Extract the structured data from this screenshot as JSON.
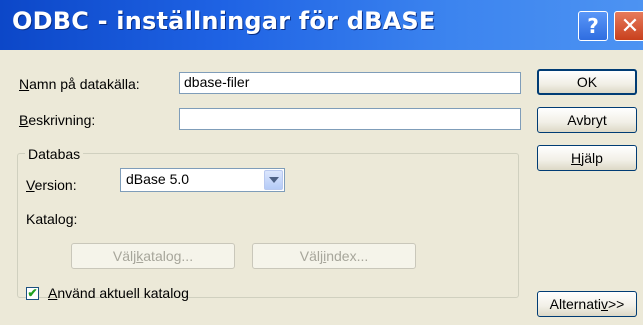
{
  "window": {
    "title": "ODBC - inställningar för dBASE",
    "help_glyph": "?",
    "close_glyph": "✕"
  },
  "form": {
    "datasource_label_key": "N",
    "datasource_label_rest": "amn på datakälla:",
    "datasource_value": "dbase-filer",
    "description_label_key": "B",
    "description_label_rest": "eskrivning:",
    "description_value": ""
  },
  "database_group": {
    "legend": "Databas",
    "version_label_key": "V",
    "version_label_rest": "ersion:",
    "version_selected": "dBase 5.0",
    "catalog_label": "Katalog:",
    "choose_catalog_pre": "Välj ",
    "choose_catalog_key": "k",
    "choose_catalog_post": "atalog...",
    "choose_index_pre": "Välj ",
    "choose_index_key": "i",
    "choose_index_post": "ndex...",
    "use_current_checked": true,
    "use_current_key": "A",
    "use_current_rest": "nvänd aktuell katalog"
  },
  "buttons": {
    "ok": "OK",
    "cancel": "Avbryt",
    "help_key": "H",
    "help_rest": "jälp",
    "options_pre": "Alternati",
    "options_key": "v",
    "options_post": ">>"
  },
  "colors": {
    "titlebar": "#1f63e4",
    "dialog_face": "#ece9d8"
  }
}
